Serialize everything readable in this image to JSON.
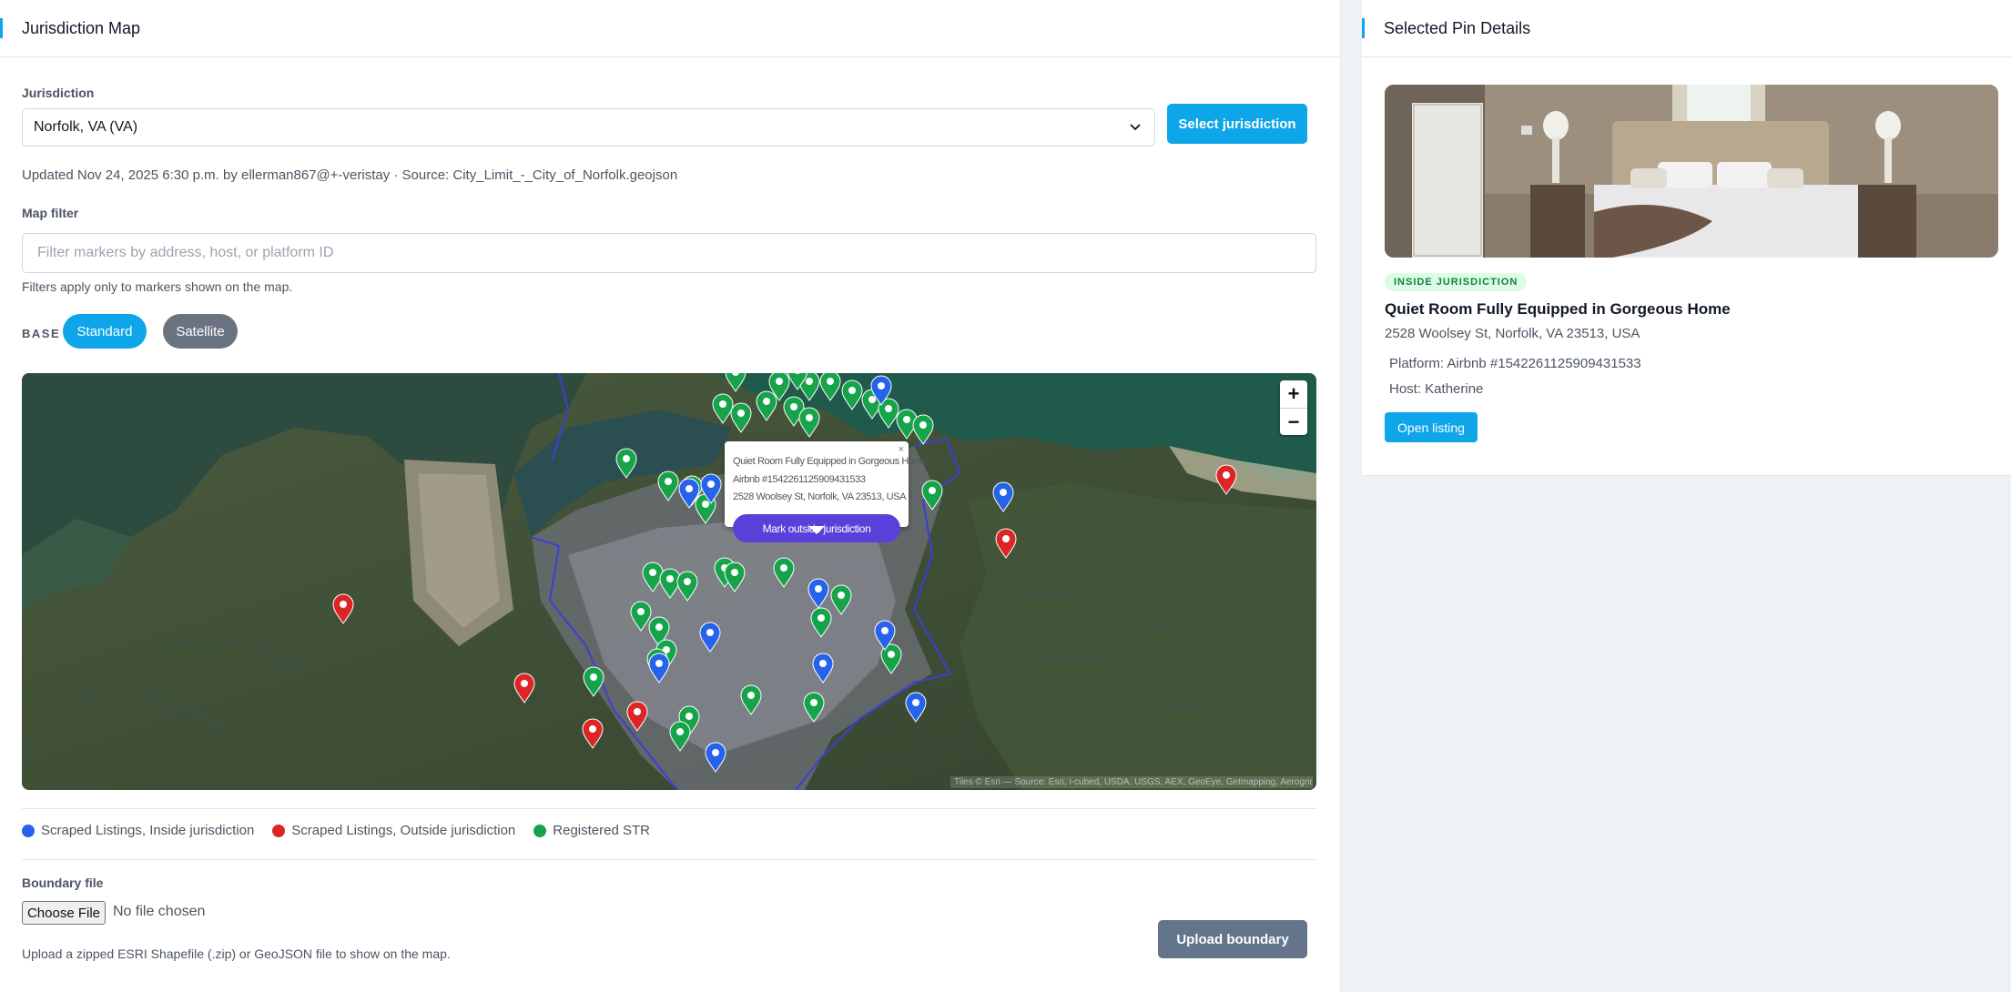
{
  "left_panel": {
    "title": "Jurisdiction Map",
    "jurisdiction_label": "Jurisdiction",
    "jurisdiction_value": "Norfolk, VA (VA)",
    "select_button": "Select jurisdiction",
    "updated_text": "Updated Nov 24, 2025 6:30 p.m. by ellerman867@+-veristay · Source: City_Limit_-_City_of_Norfolk.geojson",
    "filter_label": "Map filter",
    "filter_placeholder": "Filter markers by address, host, or platform ID",
    "filter_help": "Filters apply only to markers shown on the map.",
    "base_label": "BASE",
    "base_options": [
      "Standard",
      "Satellite"
    ],
    "active_base": "Standard"
  },
  "map": {
    "zoom_in": "+",
    "zoom_out": "−",
    "attribution": "Tiles © Esri — Source: Esri, i-cubed, USDA, USGS, AEX, GeoEye, Getmapping, Aerogrid, IGN, IGP, UPR-EGP, and the GIS User Community",
    "popup": {
      "title": "Quiet Room Fully Equipped in Gorgeous Home",
      "platform": "Airbnb #1542261125909431533",
      "address": "2528 Woolsey St, Norfolk, VA 23513, USA",
      "close": "×",
      "button": "Mark outside jurisdiction"
    }
  },
  "legend": [
    {
      "label": "Scraped Listings, Inside jurisdiction",
      "color": "#2563eb"
    },
    {
      "label": "Scraped Listings, Outside jurisdiction",
      "color": "#dc2626"
    },
    {
      "label": "Registered STR",
      "color": "#16a34a"
    }
  ],
  "boundary": {
    "label": "Boundary file",
    "choose_button": "Choose File",
    "no_file": "No file chosen",
    "help": "Upload a zipped ESRI Shapefile (.zip) or GeoJSON file to show on the map.",
    "upload_button": "Upload boundary"
  },
  "right_panel": {
    "title": "Selected Pin Details",
    "badge": "INSIDE JURISDICTION",
    "listing_title": "Quiet Room Fully Equipped in Gorgeous Home",
    "address": "2528 Woolsey St, Norfolk, VA 23513, USA",
    "platform": "Platform: Airbnb #1542261125909431533",
    "host": "Host: Katherine",
    "open_button": "Open listing"
  },
  "colors": {
    "accent": "#0ea5e9",
    "inside": "#2563eb",
    "outside": "#dc2626",
    "registered": "#16a34a",
    "popup_button": "#5b3fd9"
  }
}
